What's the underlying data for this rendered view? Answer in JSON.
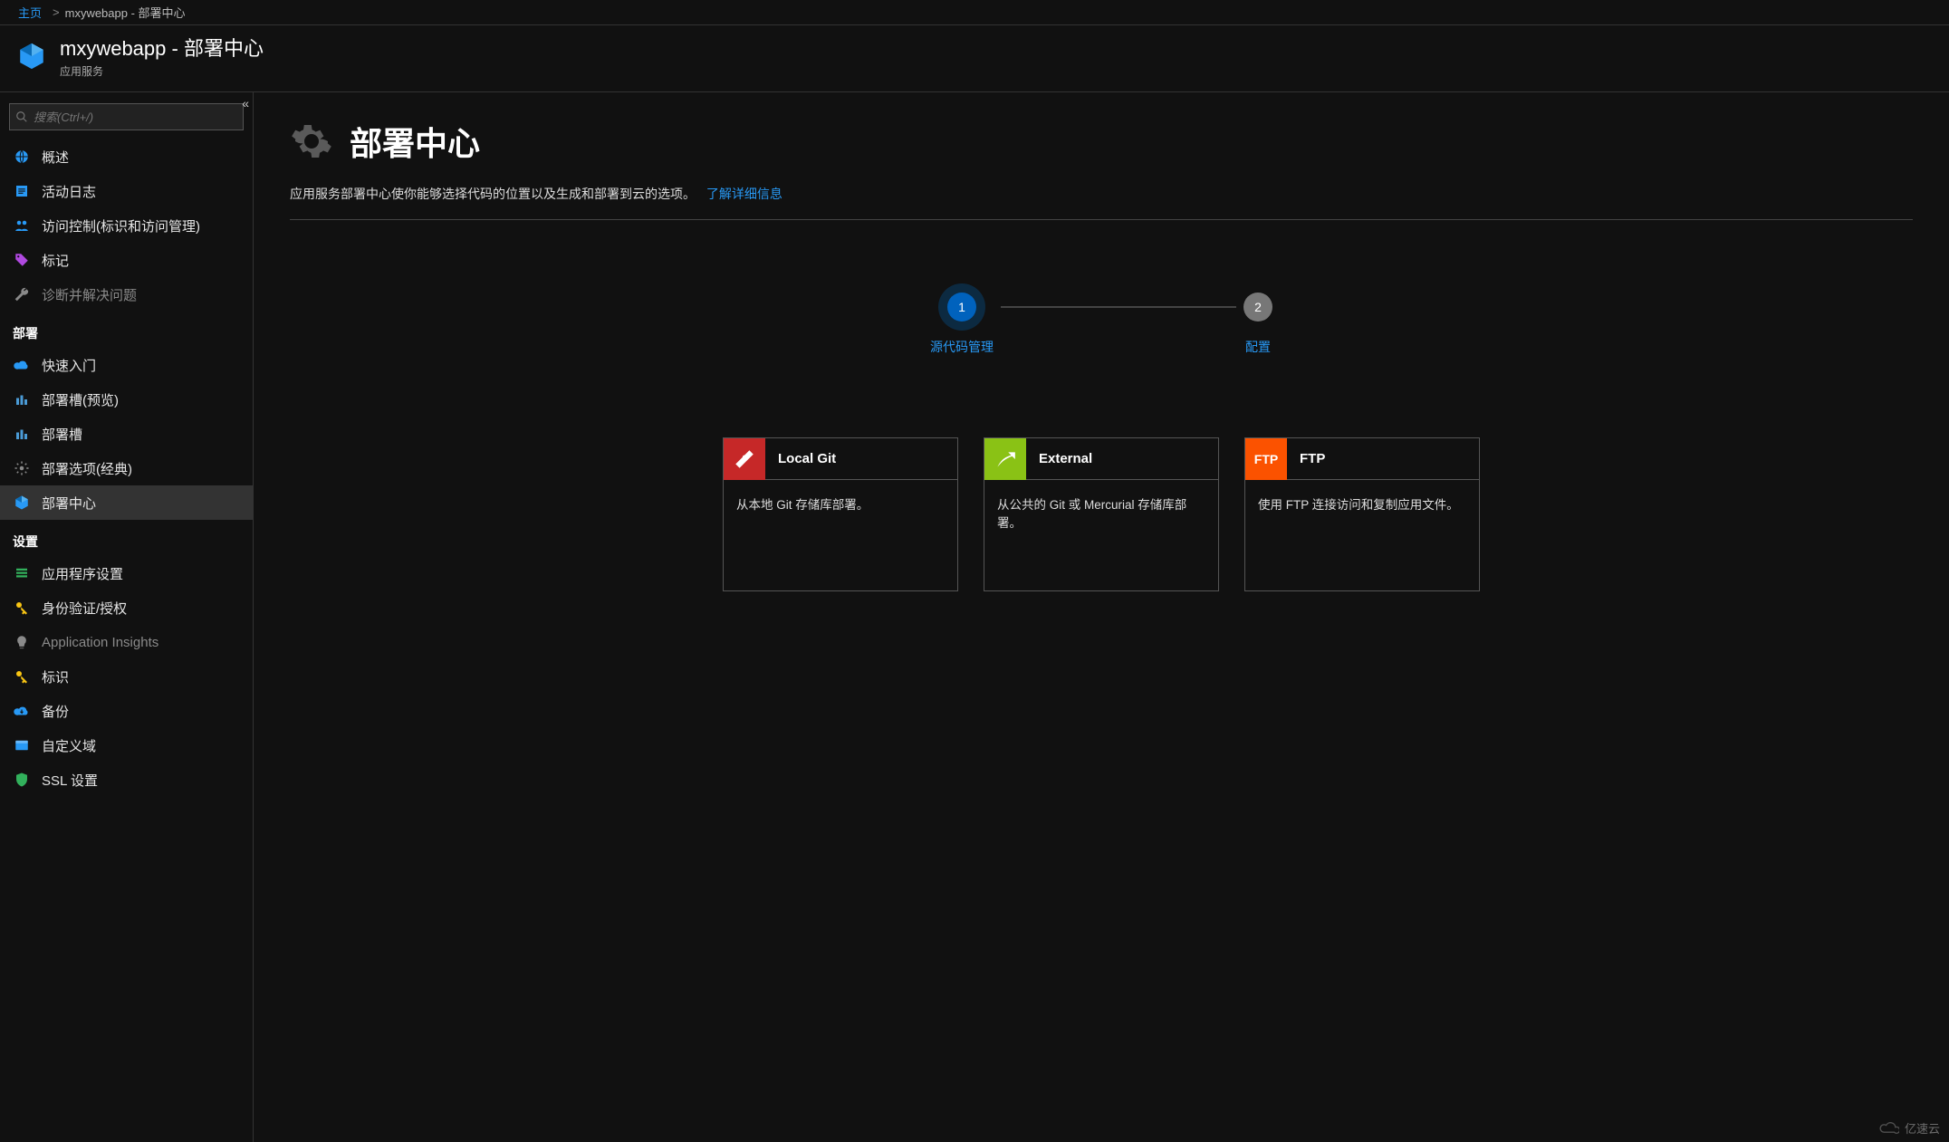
{
  "breadcrumb": {
    "home": "主页",
    "sep": ">",
    "current": "mxywebapp - 部署中心"
  },
  "titlebar": {
    "title": "mxywebapp - 部署中心",
    "subtitle": "应用服务"
  },
  "search": {
    "placeholder": "搜索(Ctrl+/)"
  },
  "nav": {
    "top": [
      {
        "label": "概述",
        "icon": "globe",
        "color": "#2899f5"
      },
      {
        "label": "活动日志",
        "icon": "log",
        "color": "#2899f5"
      },
      {
        "label": "访问控制(标识和访问管理)",
        "icon": "iam",
        "color": "#2899f5"
      },
      {
        "label": "标记",
        "icon": "tag",
        "color": "#b049e0"
      },
      {
        "label": "诊断并解决问题",
        "icon": "wrench",
        "muted": true
      }
    ],
    "sections": [
      {
        "header": "部署",
        "items": [
          {
            "label": "快速入门",
            "icon": "cloud",
            "color": "#2899f5"
          },
          {
            "label": "部署槽(预览)",
            "icon": "slots",
            "color": "#4a9bd6"
          },
          {
            "label": "部署槽",
            "icon": "slots",
            "color": "#4a9bd6"
          },
          {
            "label": "部署选项(经典)",
            "icon": "gear",
            "color": "#8a8a8a"
          },
          {
            "label": "部署中心",
            "icon": "cube",
            "color": "#2899f5",
            "active": true
          }
        ]
      },
      {
        "header": "设置",
        "items": [
          {
            "label": "应用程序设置",
            "icon": "stack",
            "color": "#32b15c"
          },
          {
            "label": "身份验证/授权",
            "icon": "key",
            "color": "#f9c513"
          },
          {
            "label": "Application Insights",
            "icon": "bulb",
            "muted": true
          },
          {
            "label": "标识",
            "icon": "key",
            "color": "#f9c513"
          },
          {
            "label": "备份",
            "icon": "cloudbk",
            "color": "#2899f5"
          },
          {
            "label": "自定义域",
            "icon": "domain",
            "color": "#2899f5"
          },
          {
            "label": "SSL 设置",
            "icon": "shield",
            "color": "#32b15c"
          }
        ]
      }
    ]
  },
  "page": {
    "title": "部署中心",
    "desc": "应用服务部署中心使你能够选择代码的位置以及生成和部署到云的选项。",
    "learn_more": "了解详细信息"
  },
  "stepper": {
    "steps": [
      {
        "num": "1",
        "label": "源代码管理",
        "active": true
      },
      {
        "num": "2",
        "label": "配置",
        "active": false
      }
    ]
  },
  "cards": [
    {
      "id": "git",
      "title": "Local Git",
      "desc": "从本地 Git 存储库部署。"
    },
    {
      "id": "external",
      "title": "External",
      "desc": "从公共的 Git 或 Mercurial 存储库部署。"
    },
    {
      "id": "ftp",
      "title": "FTP",
      "desc": "使用 FTP 连接访问和复制应用文件。",
      "badge": "FTP"
    }
  ],
  "watermark": {
    "text": "亿速云"
  }
}
